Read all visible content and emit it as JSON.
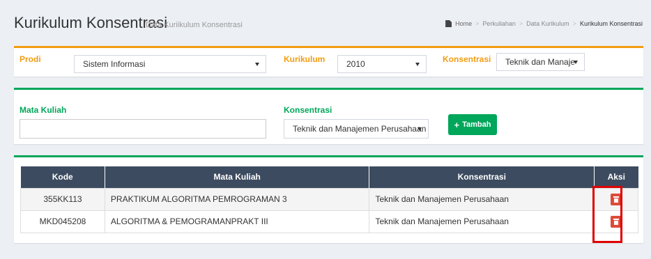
{
  "header": {
    "title": "Kurikulum Konsentrasi",
    "subtitle": "Data Kuriikulum Konsentrasi",
    "breadcrumb": [
      "Home",
      "Perkuliahan",
      "Data Kurikulum",
      "Kurikulum Konsentrasi"
    ],
    "breadcrumb_sep": ">"
  },
  "filters": {
    "prodi_label": "Prodi",
    "prodi_value": "Sistem Informasi",
    "kurikulum_label": "Kurikulum",
    "kurikulum_value": "2010",
    "konsentrasi_label": "Konsentrasi",
    "konsentrasi_value": "Teknik dan Manaje"
  },
  "form": {
    "mata_kuliah_label": "Mata Kuliah",
    "mata_kuliah_value": "",
    "konsentrasi_label": "Konsentrasi",
    "konsentrasi_value": "Teknik dan Manajemen Perusahaan",
    "add_button_label": "Tambah"
  },
  "table": {
    "headers": [
      "Kode",
      "Mata Kuliah",
      "Konsentrasi",
      "Aksi"
    ],
    "rows": [
      {
        "kode": "355KK113",
        "mata_kuliah": "PRAKTIKUM ALGORITMA PEMROGRAMAN 3",
        "konsentrasi": "Teknik dan Manajemen Perusahaan"
      },
      {
        "kode": "MKD045208",
        "mata_kuliah": "ALGORITMA & PEMOGRAMANPRAKT III",
        "konsentrasi": "Teknik dan Manajemen Perusahaan"
      }
    ]
  },
  "colors": {
    "warning": "#f39c12",
    "success": "#00a65a",
    "danger": "#dd4b39",
    "table_header": "#3c4b5f",
    "highlight": "#e00000"
  },
  "icons": {
    "home": "home-icon",
    "add": "plus-icon",
    "delete": "trash-icon"
  }
}
